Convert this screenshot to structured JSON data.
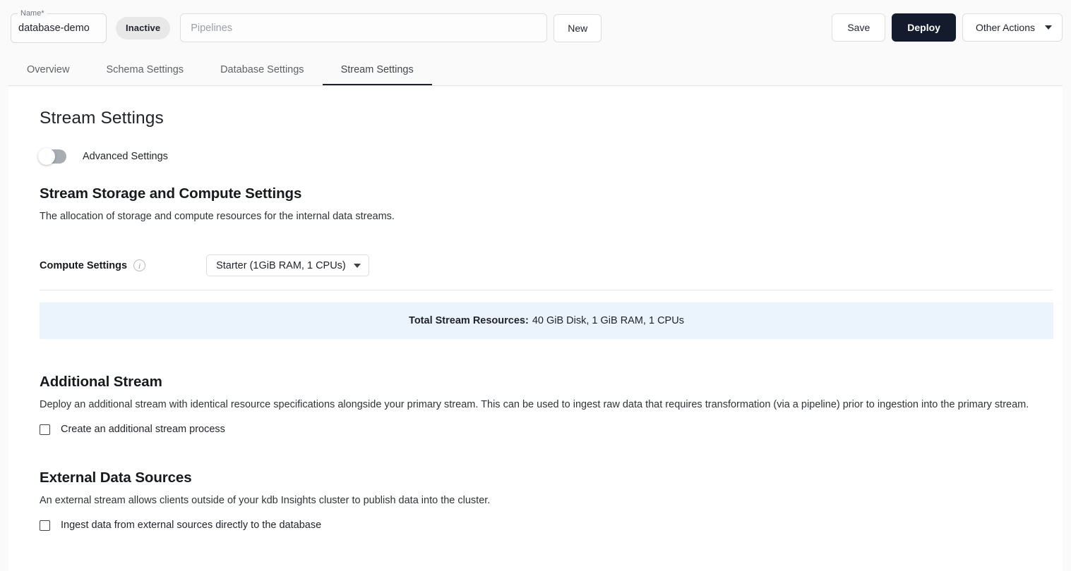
{
  "header": {
    "name_label": "Name",
    "name_required_marker": "*",
    "name_value": "database-demo",
    "status_badge": "Inactive",
    "pipelines_placeholder": "Pipelines",
    "pipelines_value": "",
    "new_button": "New",
    "save_button": "Save",
    "deploy_button": "Deploy",
    "other_actions_button": "Other Actions"
  },
  "tabs": [
    {
      "label": "Overview",
      "active": false
    },
    {
      "label": "Schema Settings",
      "active": false
    },
    {
      "label": "Database Settings",
      "active": false
    },
    {
      "label": "Stream Settings",
      "active": true
    }
  ],
  "main": {
    "page_title": "Stream Settings",
    "advanced_settings_label": "Advanced Settings",
    "advanced_settings_on": false,
    "storage_section": {
      "title": "Stream Storage and Compute Settings",
      "description": "The allocation of storage and compute resources for the internal data streams.",
      "compute_label": "Compute Settings",
      "compute_value": "Starter (1GiB RAM, 1 CPUs)"
    },
    "resources_banner": {
      "label": "Total Stream Resources:",
      "value": "40 GiB Disk, 1 GiB RAM, 1 CPUs"
    },
    "additional_stream": {
      "title": "Additional Stream",
      "description": "Deploy an additional stream with identical resource specifications alongside your primary stream. This can be used to ingest raw data that requires transformation (via a pipeline) prior to ingestion into the primary stream.",
      "checkbox_label": "Create an additional stream process",
      "checked": false
    },
    "external_data_sources": {
      "title": "External Data Sources",
      "description": "An external stream allows clients outside of your kdb Insights cluster to publish data into the cluster.",
      "checkbox_label": "Ingest data from external sources directly to the database",
      "checked": false
    }
  },
  "colors": {
    "deploy_button_bg": "#141b2d",
    "banner_bg": "#ebf3fd",
    "active_tab_underline": "#1a1f29",
    "page_bg": "#fafafa",
    "panel_bg": "#ffffff"
  }
}
